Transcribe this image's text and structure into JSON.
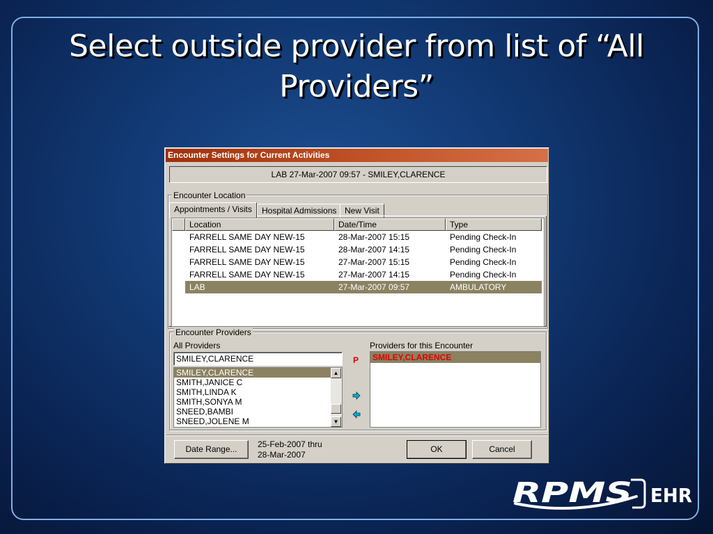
{
  "slide": {
    "title": "Select outside provider from list of “All Providers”"
  },
  "dialog": {
    "title": "Encounter Settings for Current Activities",
    "header": "LAB  27-Mar-2007 09:57  -  SMILEY,CLARENCE",
    "location_group_label": "Encounter Location",
    "tabs": [
      "Appointments / Visits",
      "Hospital Admissions",
      "New Visit"
    ],
    "active_tab": "Appointments / Visits",
    "grid": {
      "columns": [
        "Location",
        "Date/Time",
        "Type"
      ],
      "rows": [
        {
          "location": "FARRELL SAME DAY NEW-15",
          "datetime": "28-Mar-2007 15:15",
          "type": "Pending Check-In"
        },
        {
          "location": "FARRELL SAME DAY NEW-15",
          "datetime": "28-Mar-2007 14:15",
          "type": "Pending Check-In"
        },
        {
          "location": "FARRELL SAME DAY NEW-15",
          "datetime": "27-Mar-2007 15:15",
          "type": "Pending Check-In"
        },
        {
          "location": "FARRELL SAME DAY NEW-15",
          "datetime": "27-Mar-2007 14:15",
          "type": "Pending Check-In"
        },
        {
          "location": "LAB",
          "datetime": "27-Mar-2007 09:57",
          "type": "AMBULATORY"
        }
      ],
      "selected_index": 4
    },
    "providers_group_label": "Encounter Providers",
    "all_providers": {
      "label": "All Providers",
      "search_value": "SMILEY,CLARENCE",
      "items": [
        "SMILEY,CLARENCE",
        "SMITH,JANICE C",
        "SMITH,LINDA K",
        "SMITH,SONYA M",
        "SNEED,BAMBI",
        "SNEED,JOLENE M"
      ],
      "selected_index": 0
    },
    "primary_marker": "P",
    "encounter_providers": {
      "label": "Providers for this Encounter",
      "items": [
        "SMILEY,CLARENCE"
      ]
    },
    "date_range_button": "Date Range...",
    "date_range_from": "25-Feb-2007 thru",
    "date_range_to": "28-Mar-2007",
    "ok_button": "OK",
    "cancel_button": "Cancel"
  },
  "logo": {
    "brand": "RPMS",
    "suffix": "EHR"
  },
  "colors": {
    "title_bar": "#a0300a",
    "selection": "#8b8262",
    "primary_provider": "#e00000",
    "arrow": "#00a0c0"
  }
}
